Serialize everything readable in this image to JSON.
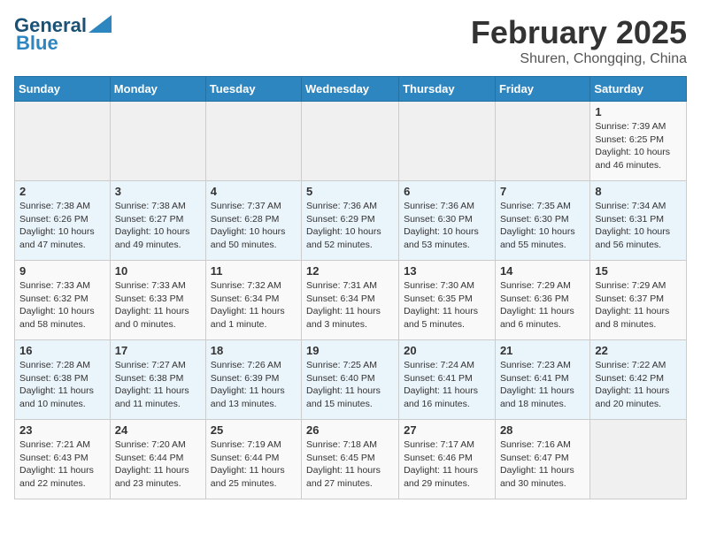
{
  "header": {
    "logo_general": "General",
    "logo_blue": "Blue",
    "title": "February 2025",
    "subtitle": "Shuren, Chongqing, China"
  },
  "weekdays": [
    "Sunday",
    "Monday",
    "Tuesday",
    "Wednesday",
    "Thursday",
    "Friday",
    "Saturday"
  ],
  "weeks": [
    [
      {
        "day": "",
        "info": ""
      },
      {
        "day": "",
        "info": ""
      },
      {
        "day": "",
        "info": ""
      },
      {
        "day": "",
        "info": ""
      },
      {
        "day": "",
        "info": ""
      },
      {
        "day": "",
        "info": ""
      },
      {
        "day": "1",
        "info": "Sunrise: 7:39 AM\nSunset: 6:25 PM\nDaylight: 10 hours\nand 46 minutes."
      }
    ],
    [
      {
        "day": "2",
        "info": "Sunrise: 7:38 AM\nSunset: 6:26 PM\nDaylight: 10 hours\nand 47 minutes."
      },
      {
        "day": "3",
        "info": "Sunrise: 7:38 AM\nSunset: 6:27 PM\nDaylight: 10 hours\nand 49 minutes."
      },
      {
        "day": "4",
        "info": "Sunrise: 7:37 AM\nSunset: 6:28 PM\nDaylight: 10 hours\nand 50 minutes."
      },
      {
        "day": "5",
        "info": "Sunrise: 7:36 AM\nSunset: 6:29 PM\nDaylight: 10 hours\nand 52 minutes."
      },
      {
        "day": "6",
        "info": "Sunrise: 7:36 AM\nSunset: 6:30 PM\nDaylight: 10 hours\nand 53 minutes."
      },
      {
        "day": "7",
        "info": "Sunrise: 7:35 AM\nSunset: 6:30 PM\nDaylight: 10 hours\nand 55 minutes."
      },
      {
        "day": "8",
        "info": "Sunrise: 7:34 AM\nSunset: 6:31 PM\nDaylight: 10 hours\nand 56 minutes."
      }
    ],
    [
      {
        "day": "9",
        "info": "Sunrise: 7:33 AM\nSunset: 6:32 PM\nDaylight: 10 hours\nand 58 minutes."
      },
      {
        "day": "10",
        "info": "Sunrise: 7:33 AM\nSunset: 6:33 PM\nDaylight: 11 hours\nand 0 minutes."
      },
      {
        "day": "11",
        "info": "Sunrise: 7:32 AM\nSunset: 6:34 PM\nDaylight: 11 hours\nand 1 minute."
      },
      {
        "day": "12",
        "info": "Sunrise: 7:31 AM\nSunset: 6:34 PM\nDaylight: 11 hours\nand 3 minutes."
      },
      {
        "day": "13",
        "info": "Sunrise: 7:30 AM\nSunset: 6:35 PM\nDaylight: 11 hours\nand 5 minutes."
      },
      {
        "day": "14",
        "info": "Sunrise: 7:29 AM\nSunset: 6:36 PM\nDaylight: 11 hours\nand 6 minutes."
      },
      {
        "day": "15",
        "info": "Sunrise: 7:29 AM\nSunset: 6:37 PM\nDaylight: 11 hours\nand 8 minutes."
      }
    ],
    [
      {
        "day": "16",
        "info": "Sunrise: 7:28 AM\nSunset: 6:38 PM\nDaylight: 11 hours\nand 10 minutes."
      },
      {
        "day": "17",
        "info": "Sunrise: 7:27 AM\nSunset: 6:38 PM\nDaylight: 11 hours\nand 11 minutes."
      },
      {
        "day": "18",
        "info": "Sunrise: 7:26 AM\nSunset: 6:39 PM\nDaylight: 11 hours\nand 13 minutes."
      },
      {
        "day": "19",
        "info": "Sunrise: 7:25 AM\nSunset: 6:40 PM\nDaylight: 11 hours\nand 15 minutes."
      },
      {
        "day": "20",
        "info": "Sunrise: 7:24 AM\nSunset: 6:41 PM\nDaylight: 11 hours\nand 16 minutes."
      },
      {
        "day": "21",
        "info": "Sunrise: 7:23 AM\nSunset: 6:41 PM\nDaylight: 11 hours\nand 18 minutes."
      },
      {
        "day": "22",
        "info": "Sunrise: 7:22 AM\nSunset: 6:42 PM\nDaylight: 11 hours\nand 20 minutes."
      }
    ],
    [
      {
        "day": "23",
        "info": "Sunrise: 7:21 AM\nSunset: 6:43 PM\nDaylight: 11 hours\nand 22 minutes."
      },
      {
        "day": "24",
        "info": "Sunrise: 7:20 AM\nSunset: 6:44 PM\nDaylight: 11 hours\nand 23 minutes."
      },
      {
        "day": "25",
        "info": "Sunrise: 7:19 AM\nSunset: 6:44 PM\nDaylight: 11 hours\nand 25 minutes."
      },
      {
        "day": "26",
        "info": "Sunrise: 7:18 AM\nSunset: 6:45 PM\nDaylight: 11 hours\nand 27 minutes."
      },
      {
        "day": "27",
        "info": "Sunrise: 7:17 AM\nSunset: 6:46 PM\nDaylight: 11 hours\nand 29 minutes."
      },
      {
        "day": "28",
        "info": "Sunrise: 7:16 AM\nSunset: 6:47 PM\nDaylight: 11 hours\nand 30 minutes."
      },
      {
        "day": "",
        "info": ""
      }
    ]
  ]
}
